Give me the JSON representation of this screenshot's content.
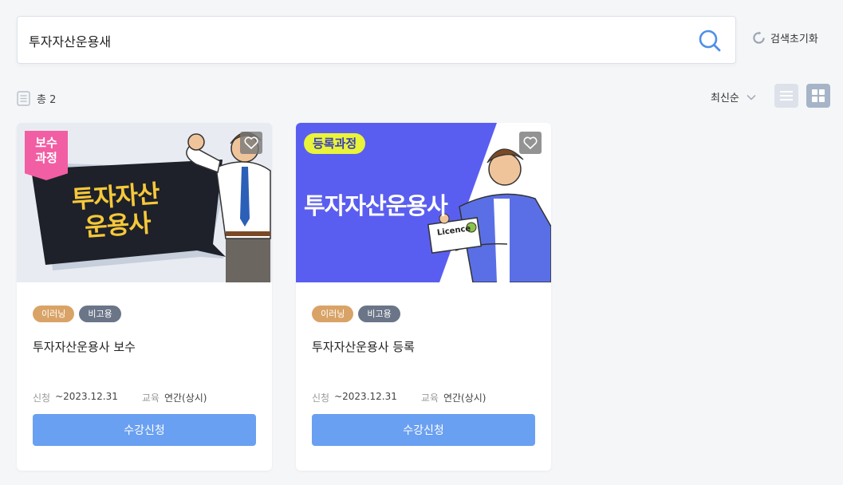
{
  "search": {
    "value": "투자자산운용새",
    "reset_label": "검색초기화"
  },
  "toolbar": {
    "count_label": "총 2",
    "sort_label": "최신순"
  },
  "cards": [
    {
      "ribbon": "보수\n과정",
      "thumb_title_line1": "투자자산",
      "thumb_title_line2": "운용사",
      "badges": [
        "이러닝",
        "비고용"
      ],
      "title": "투자자산운용사 보수",
      "apply_key": "신청",
      "apply_value": "~2023.12.31",
      "edu_key": "교육",
      "edu_value": "연간(상시)",
      "button_label": "수강신청"
    },
    {
      "pill_tag": "등록과정",
      "thumb_title": "투자자산운용사",
      "licence_text": "Licence",
      "badges": [
        "이러닝",
        "비고용"
      ],
      "title": "투자자산운용사 등록",
      "apply_key": "신청",
      "apply_value": "~2023.12.31",
      "edu_key": "교육",
      "edu_value": "연간(상시)",
      "button_label": "수강신청"
    }
  ],
  "colors": {
    "accent_button": "#6aa0f1",
    "ribbon_pink": "#f25ea3",
    "badge_elearn": "#d9a367",
    "badge_cost": "#6b7588",
    "thumb2_blue": "#5a5ef0"
  }
}
